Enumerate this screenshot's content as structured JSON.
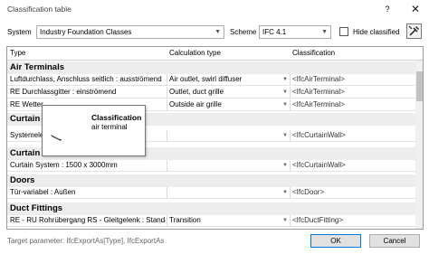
{
  "window": {
    "title": "Classification table",
    "help_label": "?",
    "close_label": "✕"
  },
  "toolbar": {
    "system_label": "System",
    "system_value": "Industry Foundation Classes",
    "scheme_label": "Scheme",
    "scheme_value": "IFC 4.1",
    "hide_classified_label": "Hide classified",
    "hide_classified_checked": false
  },
  "table": {
    "columns": [
      "Type",
      "Calculation type",
      "Classification"
    ],
    "groups": [
      {
        "name": "Air Terminals",
        "rows": [
          [
            "Luftdurchlass, Anschluss seitlich : ausströmend",
            "Air outlet, swirl diffuser",
            "<IfcAirTerminal>"
          ],
          [
            "RE Durchlassgitter : einströmend",
            "Outlet, duct grille",
            "<IfcAirTerminal>"
          ],
          [
            "RE Wetter",
            "Outside air grille",
            "<IfcAirTerminal>"
          ]
        ]
      },
      {
        "name": "Curtain",
        "rows": [
          [
            "Systemele",
            "",
            "<IfcCurtainWall>"
          ]
        ]
      },
      {
        "name": "Curtain",
        "rows": [
          [
            "Curtain System : 1500 x 3000mm",
            "",
            "<IfcCurtainWall>"
          ]
        ]
      },
      {
        "name": "Doors",
        "rows": [
          [
            "Tür-variabel : Außen",
            "",
            "<IfcDoor>"
          ]
        ]
      },
      {
        "name": "Duct Fittings",
        "rows": [
          [
            "RE - RU Rohrübergang RS - Gleitgelenk : Standa",
            "Transition",
            "<IfcDuctFitting>"
          ]
        ]
      }
    ]
  },
  "tooltip": {
    "title": "Classification",
    "value": "air terminal"
  },
  "footer": {
    "target_parameter": "Target parameter: IfcExportAs[Type], IfcExportAs",
    "ok_label": "OK",
    "cancel_label": "Cancel"
  }
}
